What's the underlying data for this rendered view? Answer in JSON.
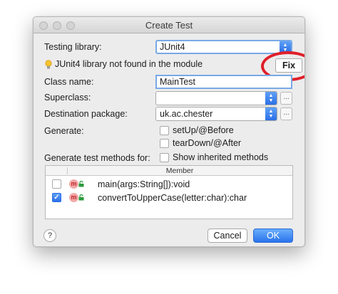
{
  "window": {
    "title": "Create Test"
  },
  "testing_library": {
    "label": "Testing library:",
    "value": "JUnit4"
  },
  "warning": {
    "text": "JUnit4 library not found in the module",
    "fix_label": "Fix"
  },
  "class_name": {
    "label": "Class name:",
    "value": "MainTest"
  },
  "superclass": {
    "label": "Superclass:",
    "value": ""
  },
  "destination": {
    "label": "Destination package:",
    "value": "uk.ac.chester"
  },
  "generate": {
    "label": "Generate:",
    "options": [
      {
        "label": "setUp/@Before",
        "checked": false
      },
      {
        "label": "tearDown/@After",
        "checked": false
      }
    ]
  },
  "methods": {
    "label": "Generate test methods for:",
    "show_inherited": {
      "label": "Show inherited methods",
      "checked": false
    },
    "column_header": "Member",
    "rows": [
      {
        "signature": "main(args:String[]):void",
        "checked": false
      },
      {
        "signature": "convertToUpperCase(letter:char):char",
        "checked": true
      }
    ]
  },
  "buttons": {
    "help": "?",
    "cancel": "Cancel",
    "ok": "OK"
  },
  "icons": {
    "method": "m",
    "ellipsis": "...",
    "check": "✓",
    "lock": "🔒"
  },
  "colors": {
    "accent": "#2b6fe6",
    "highlight_circle": "#e0202a"
  }
}
